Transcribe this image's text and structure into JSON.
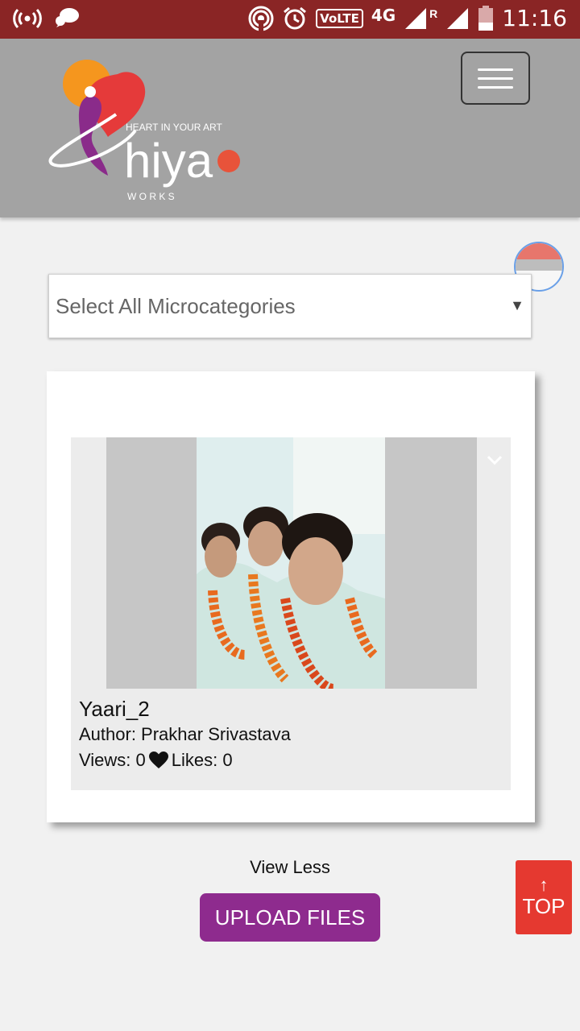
{
  "status_bar": {
    "time": "11:16",
    "volte": "VoLTE",
    "network": "4G",
    "roaming": "R",
    "icons": [
      "hotspot-icon",
      "chat-icon",
      "cast-icon",
      "alarm-icon",
      "signal-icon",
      "battery-icon"
    ]
  },
  "header": {
    "logo": {
      "tagline": "HEART IN YOUR ART",
      "brand": "hiya",
      "sub": "W O R K S"
    },
    "menu_icon": "hamburger-icon"
  },
  "filter": {
    "selected": "Select All Microcategories",
    "arrow_icon": "dropdown-arrow-icon"
  },
  "gallery": {
    "items": [
      {
        "title": "Yaari_2",
        "author": "Author: Prakhar Srivastava",
        "views": "Views: 0",
        "likes": "Likes: 0",
        "like_icon": "heart-icon",
        "menu_icon": "chevron-down-icon"
      }
    ]
  },
  "actions": {
    "view_less": "View Less",
    "upload": "UPLOAD FILES",
    "top_arrow": "↑",
    "top_label": "TOP"
  },
  "colors": {
    "status_bar": "#8a2525",
    "header": "#a3a3a3",
    "upload_button": "#8e2b8e",
    "top_button": "#e53930"
  }
}
